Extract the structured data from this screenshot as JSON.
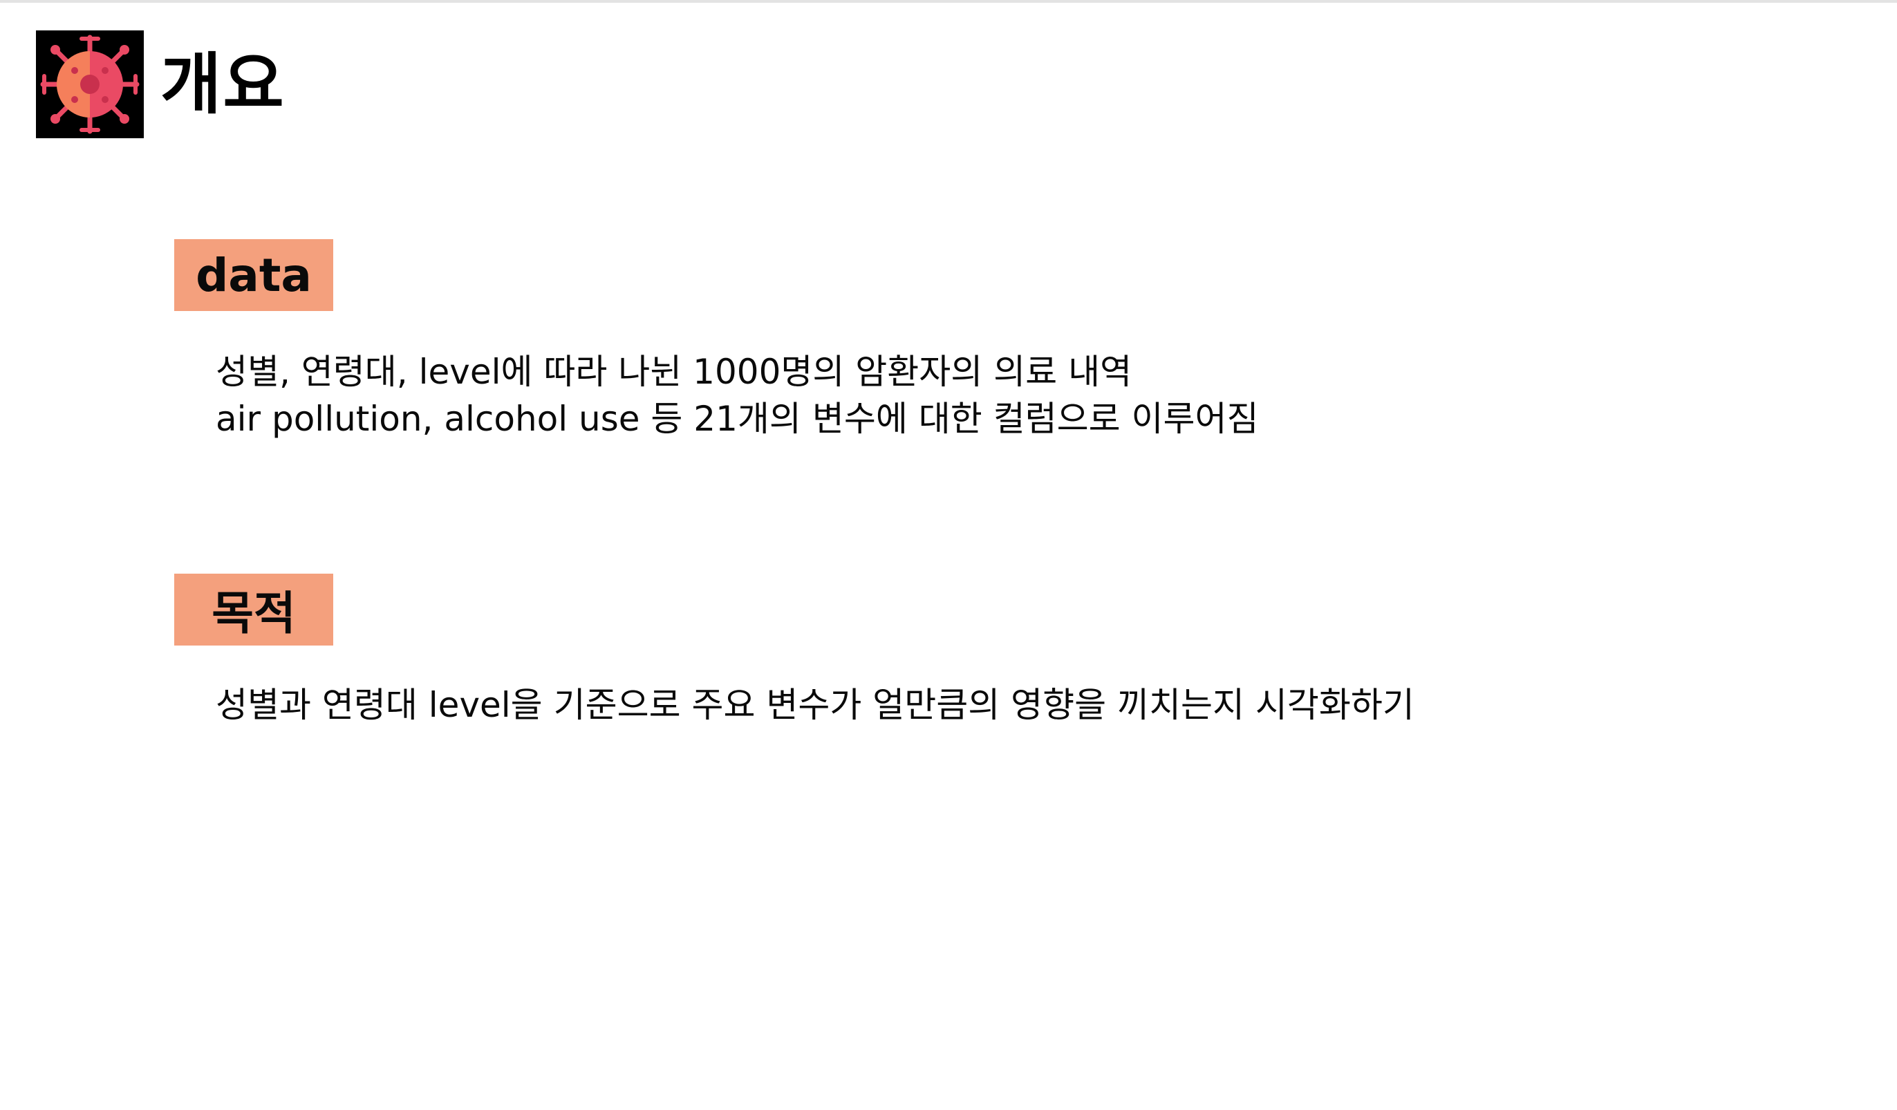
{
  "slide": {
    "title": "개요",
    "logo_icon": "virus-icon",
    "accent_color": "#f4a07d"
  },
  "sections": [
    {
      "label": "data",
      "lines": [
        "성별, 연령대, level에 따라 나뉜 1000명의 암환자의 의료 내역",
        "air pollution, alcohol use 등 21개의 변수에 대한 컬럼으로 이루어짐"
      ]
    },
    {
      "label": "목적",
      "lines": [
        "성별과 연령대 level을 기준으로 주요 변수가 얼만큼의 영향을 끼치는지 시각화하기"
      ]
    }
  ]
}
